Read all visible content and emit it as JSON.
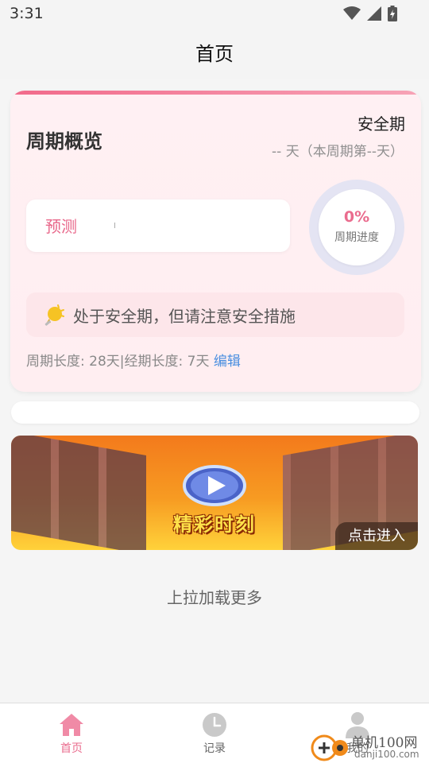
{
  "status_bar": {
    "time": "3:31",
    "icons": [
      "wifi-icon",
      "signal-icon",
      "battery-icon"
    ]
  },
  "header": {
    "title": "首页"
  },
  "cycle_card": {
    "title": "周期概览",
    "phase": "安全期",
    "phase_days": "-- 天（本周期第--天）",
    "predict_label": "预测",
    "progress": {
      "value": "0%",
      "label": "周期进度",
      "fraction": 0
    },
    "tip": {
      "icon": "lightbulb-icon",
      "text": "处于安全期，但请注意安全措施"
    },
    "cycle_length": "周期长度: 28天",
    "separator": "|",
    "period_length": "经期长度: 7天",
    "edit_label": "编辑"
  },
  "banner": {
    "title": "精彩时刻",
    "enter_label": "点击进入",
    "icon": "play-icon"
  },
  "load_more": "上拉加载更多",
  "tabbar": {
    "items": [
      {
        "label": "首页",
        "icon": "home-icon",
        "active": true
      },
      {
        "label": "记录",
        "icon": "clock-icon",
        "active": false
      },
      {
        "label": "我的",
        "icon": "person-icon",
        "active": false
      }
    ]
  },
  "watermark": {
    "text": "单机100网",
    "sub": "danji100.com"
  },
  "colors": {
    "accent": "#ea6c8e",
    "link": "#4a8fe0",
    "card_bg": "#fff0f3",
    "tip_bg": "#fde6ea"
  }
}
